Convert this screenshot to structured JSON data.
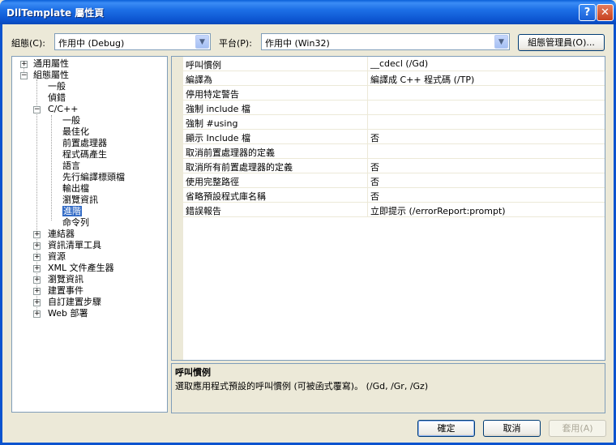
{
  "window": {
    "title": "DllTemplate 屬性頁",
    "help_label": "?",
    "close_label": "✕"
  },
  "config": {
    "configuration_label": "組態(C):",
    "configuration_value": "作用中 (Debug)",
    "platform_label": "平台(P):",
    "platform_value": "作用中 (Win32)",
    "manager_button": "組態管理員(O)..."
  },
  "tree": {
    "common_properties": "通用屬性",
    "config_properties": "組態屬性",
    "general": "一般",
    "debugging": "偵錯",
    "c_cpp": "C/C++",
    "c_general": "一般",
    "optimization": "最佳化",
    "preprocessor": "前置處理器",
    "code_generation": "程式碼產生",
    "language": "語言",
    "precompiled_headers": "先行編譯標頭檔",
    "output_files": "輸出檔",
    "browse_info": "瀏覽資訊",
    "advanced": "進階",
    "command_line": "命令列",
    "linker": "連結器",
    "manifest_tool": "資訊清單工具",
    "resources": "資源",
    "xml_doc_generator": "XML 文件產生器",
    "browse_information": "瀏覽資訊",
    "build_events": "建置事件",
    "custom_build_step": "自訂建置步驟",
    "web_deployment": "Web 部署"
  },
  "properties": [
    {
      "name": "呼叫慣例",
      "value": "__cdecl (/Gd)"
    },
    {
      "name": "編譯為",
      "value": "編譯成 C++ 程式碼 (/TP)"
    },
    {
      "name": "停用特定警告",
      "value": ""
    },
    {
      "name": "強制 include 檔",
      "value": ""
    },
    {
      "name": "強制 #using",
      "value": ""
    },
    {
      "name": "顯示 Include 檔",
      "value": "否"
    },
    {
      "name": "取消前置處理器的定義",
      "value": ""
    },
    {
      "name": "取消所有前置處理器的定義",
      "value": "否"
    },
    {
      "name": "使用完整路徑",
      "value": "否"
    },
    {
      "name": "省略預設程式庫名稱",
      "value": "否"
    },
    {
      "name": "錯誤報告",
      "value": "立即提示 (/errorReport:prompt)"
    }
  ],
  "description": {
    "title": "呼叫慣例",
    "text": "選取應用程式預設的呼叫慣例 (可被函式覆寫)。     (/Gd, /Gr, /Gz)"
  },
  "buttons": {
    "ok": "確定",
    "cancel": "取消",
    "apply": "套用(A)"
  },
  "colors": {
    "titlebar": "#0b53cf",
    "selection": "#316ac5",
    "dialog_bg": "#ece9d8"
  }
}
